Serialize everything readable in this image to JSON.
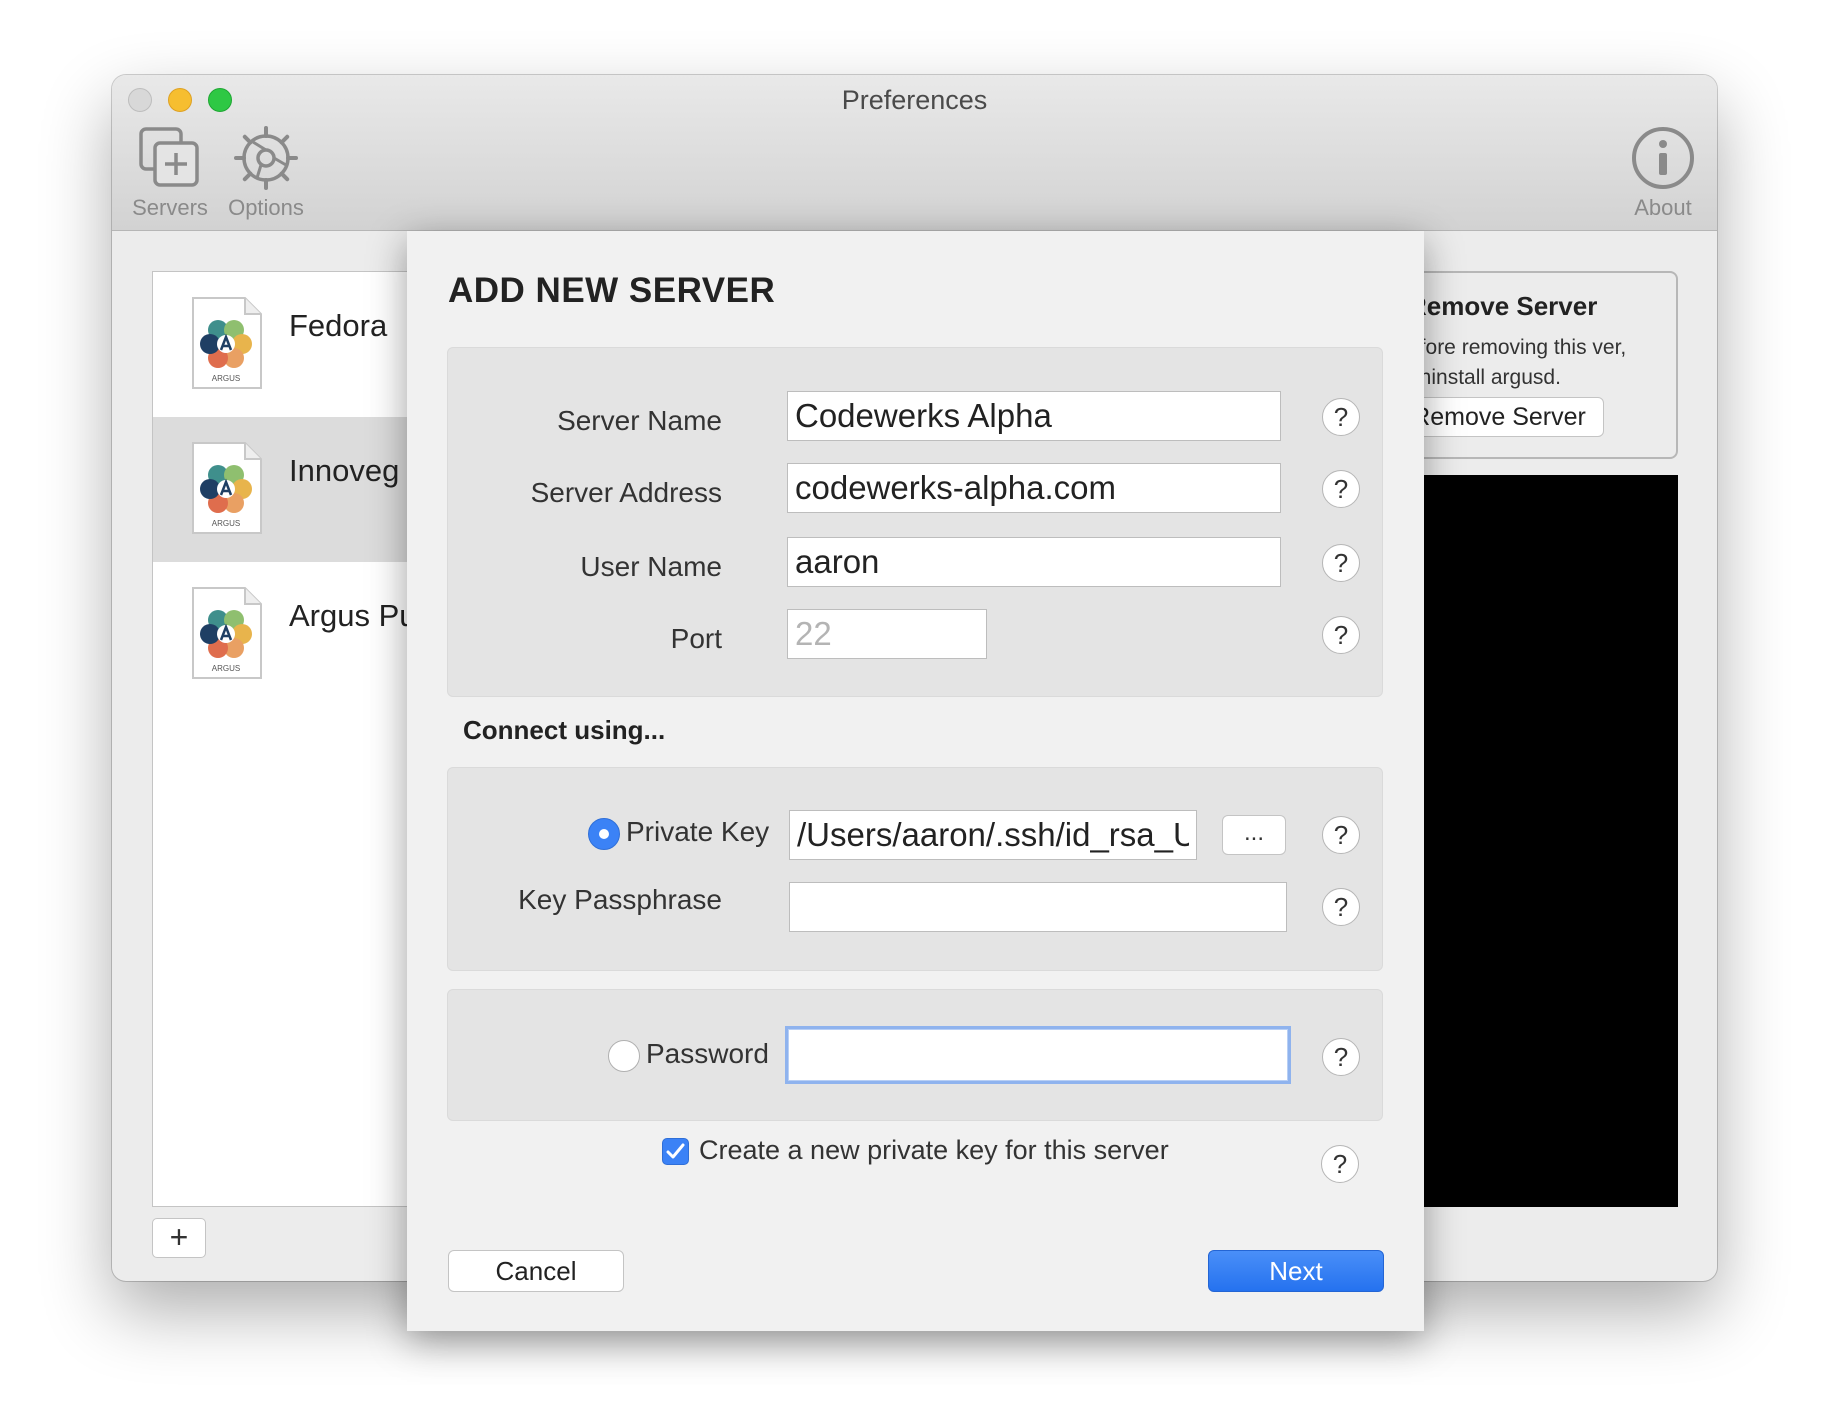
{
  "window": {
    "title": "Preferences"
  },
  "toolbar": {
    "servers_label": "Servers",
    "options_label": "Options",
    "about_label": "About"
  },
  "servers": [
    {
      "name": "Fedora",
      "icon_label": "ARGUS",
      "selected": false
    },
    {
      "name": "Innoveg",
      "icon_label": "ARGUS",
      "selected": true
    },
    {
      "name": "Argus Pu",
      "icon_label": "ARGUS",
      "selected": false
    }
  ],
  "list_controls": {
    "add_label": "+"
  },
  "remove_panel": {
    "title": "Remove Server",
    "description": "efore removing this ver, uninstall argusd.",
    "button_label": "Remove Server"
  },
  "sheet": {
    "title": "ADD NEW SERVER",
    "fields": {
      "server_name": {
        "label": "Server Name",
        "value": "Codewerks Alpha"
      },
      "server_address": {
        "label": "Server Address",
        "value": "codewerks-alpha.com"
      },
      "user_name": {
        "label": "User Name",
        "value": "aaron"
      },
      "port": {
        "label": "Port",
        "value": "",
        "placeholder": "22"
      }
    },
    "connect_label": "Connect using...",
    "private_key": {
      "label": "Private Key",
      "value": "/Users/aaron/.ssh/id_rsa_U",
      "browse_label": "...",
      "selected": true
    },
    "key_passphrase": {
      "label": "Key Passphrase",
      "value": ""
    },
    "password": {
      "label": "Password",
      "value": "",
      "selected": false
    },
    "create_key": {
      "label": "Create a new private key for this server",
      "checked": true
    },
    "help_label": "?",
    "cancel_label": "Cancel",
    "next_label": "Next"
  },
  "colors": {
    "accent": "#3b82f6",
    "selected_row": "#dcdcdc",
    "panel": "#000000"
  }
}
